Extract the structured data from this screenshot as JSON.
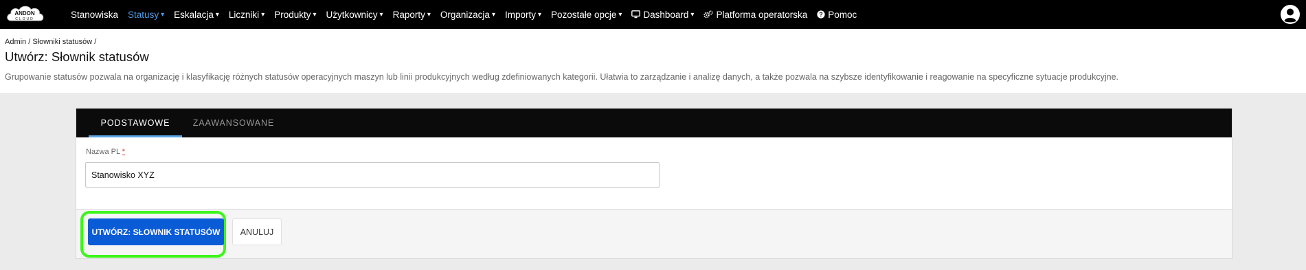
{
  "app": {
    "logo_text": "ANDON CLOUD",
    "brand_color": "#000000",
    "accent_color": "#4d9be6"
  },
  "nav": {
    "items": [
      {
        "label": "Stanowiska",
        "has_caret": false,
        "active": false,
        "icon": ""
      },
      {
        "label": "Statusy",
        "has_caret": true,
        "active": true,
        "icon": ""
      },
      {
        "label": "Eskalacja",
        "has_caret": true,
        "active": false,
        "icon": ""
      },
      {
        "label": "Liczniki",
        "has_caret": true,
        "active": false,
        "icon": ""
      },
      {
        "label": "Produkty",
        "has_caret": true,
        "active": false,
        "icon": ""
      },
      {
        "label": "Użytkownicy",
        "has_caret": true,
        "active": false,
        "icon": ""
      },
      {
        "label": "Raporty",
        "has_caret": true,
        "active": false,
        "icon": ""
      },
      {
        "label": "Organizacja",
        "has_caret": true,
        "active": false,
        "icon": ""
      },
      {
        "label": "Importy",
        "has_caret": true,
        "active": false,
        "icon": ""
      },
      {
        "label": "Pozostałe opcje",
        "has_caret": true,
        "active": false,
        "icon": ""
      },
      {
        "label": "Dashboard",
        "has_caret": true,
        "active": false,
        "icon": "monitor-icon"
      },
      {
        "label": "Platforma operatorska",
        "has_caret": false,
        "active": false,
        "icon": "gears-icon"
      },
      {
        "label": "Pomoc",
        "has_caret": false,
        "active": false,
        "icon": "question-circle-icon"
      }
    ],
    "caret": "▾",
    "user_icon": "user-circle-icon"
  },
  "header": {
    "breadcrumb": "Admin / Słowniki statusów /",
    "title": "Utwórz: Słownik statusów",
    "description": "Grupowanie statusów pozwala na organizację i klasyfikację różnych statusów operacyjnych maszyn lub linii produkcyjnych według zdefiniowanych kategorii. Ułatwia to zarządzanie i analizę danych, a także pozwala na szybsze identyfikowanie i reagowanie na specyficzne sytuacje produkcyjne."
  },
  "form": {
    "tabs": [
      {
        "label": "PODSTAWOWE",
        "active": true
      },
      {
        "label": "ZAAWANSOWANE",
        "active": false
      }
    ],
    "field": {
      "label": "Nazwa PL",
      "required_mark": "*",
      "value": "Stanowisko XYZ"
    },
    "buttons": {
      "create_label": "UTWÓRZ: SŁOWNIK STATUSÓW",
      "cancel_label": "ANULUJ"
    },
    "highlight_color": "#3ef51c",
    "primary_color": "#0a5bd6"
  }
}
